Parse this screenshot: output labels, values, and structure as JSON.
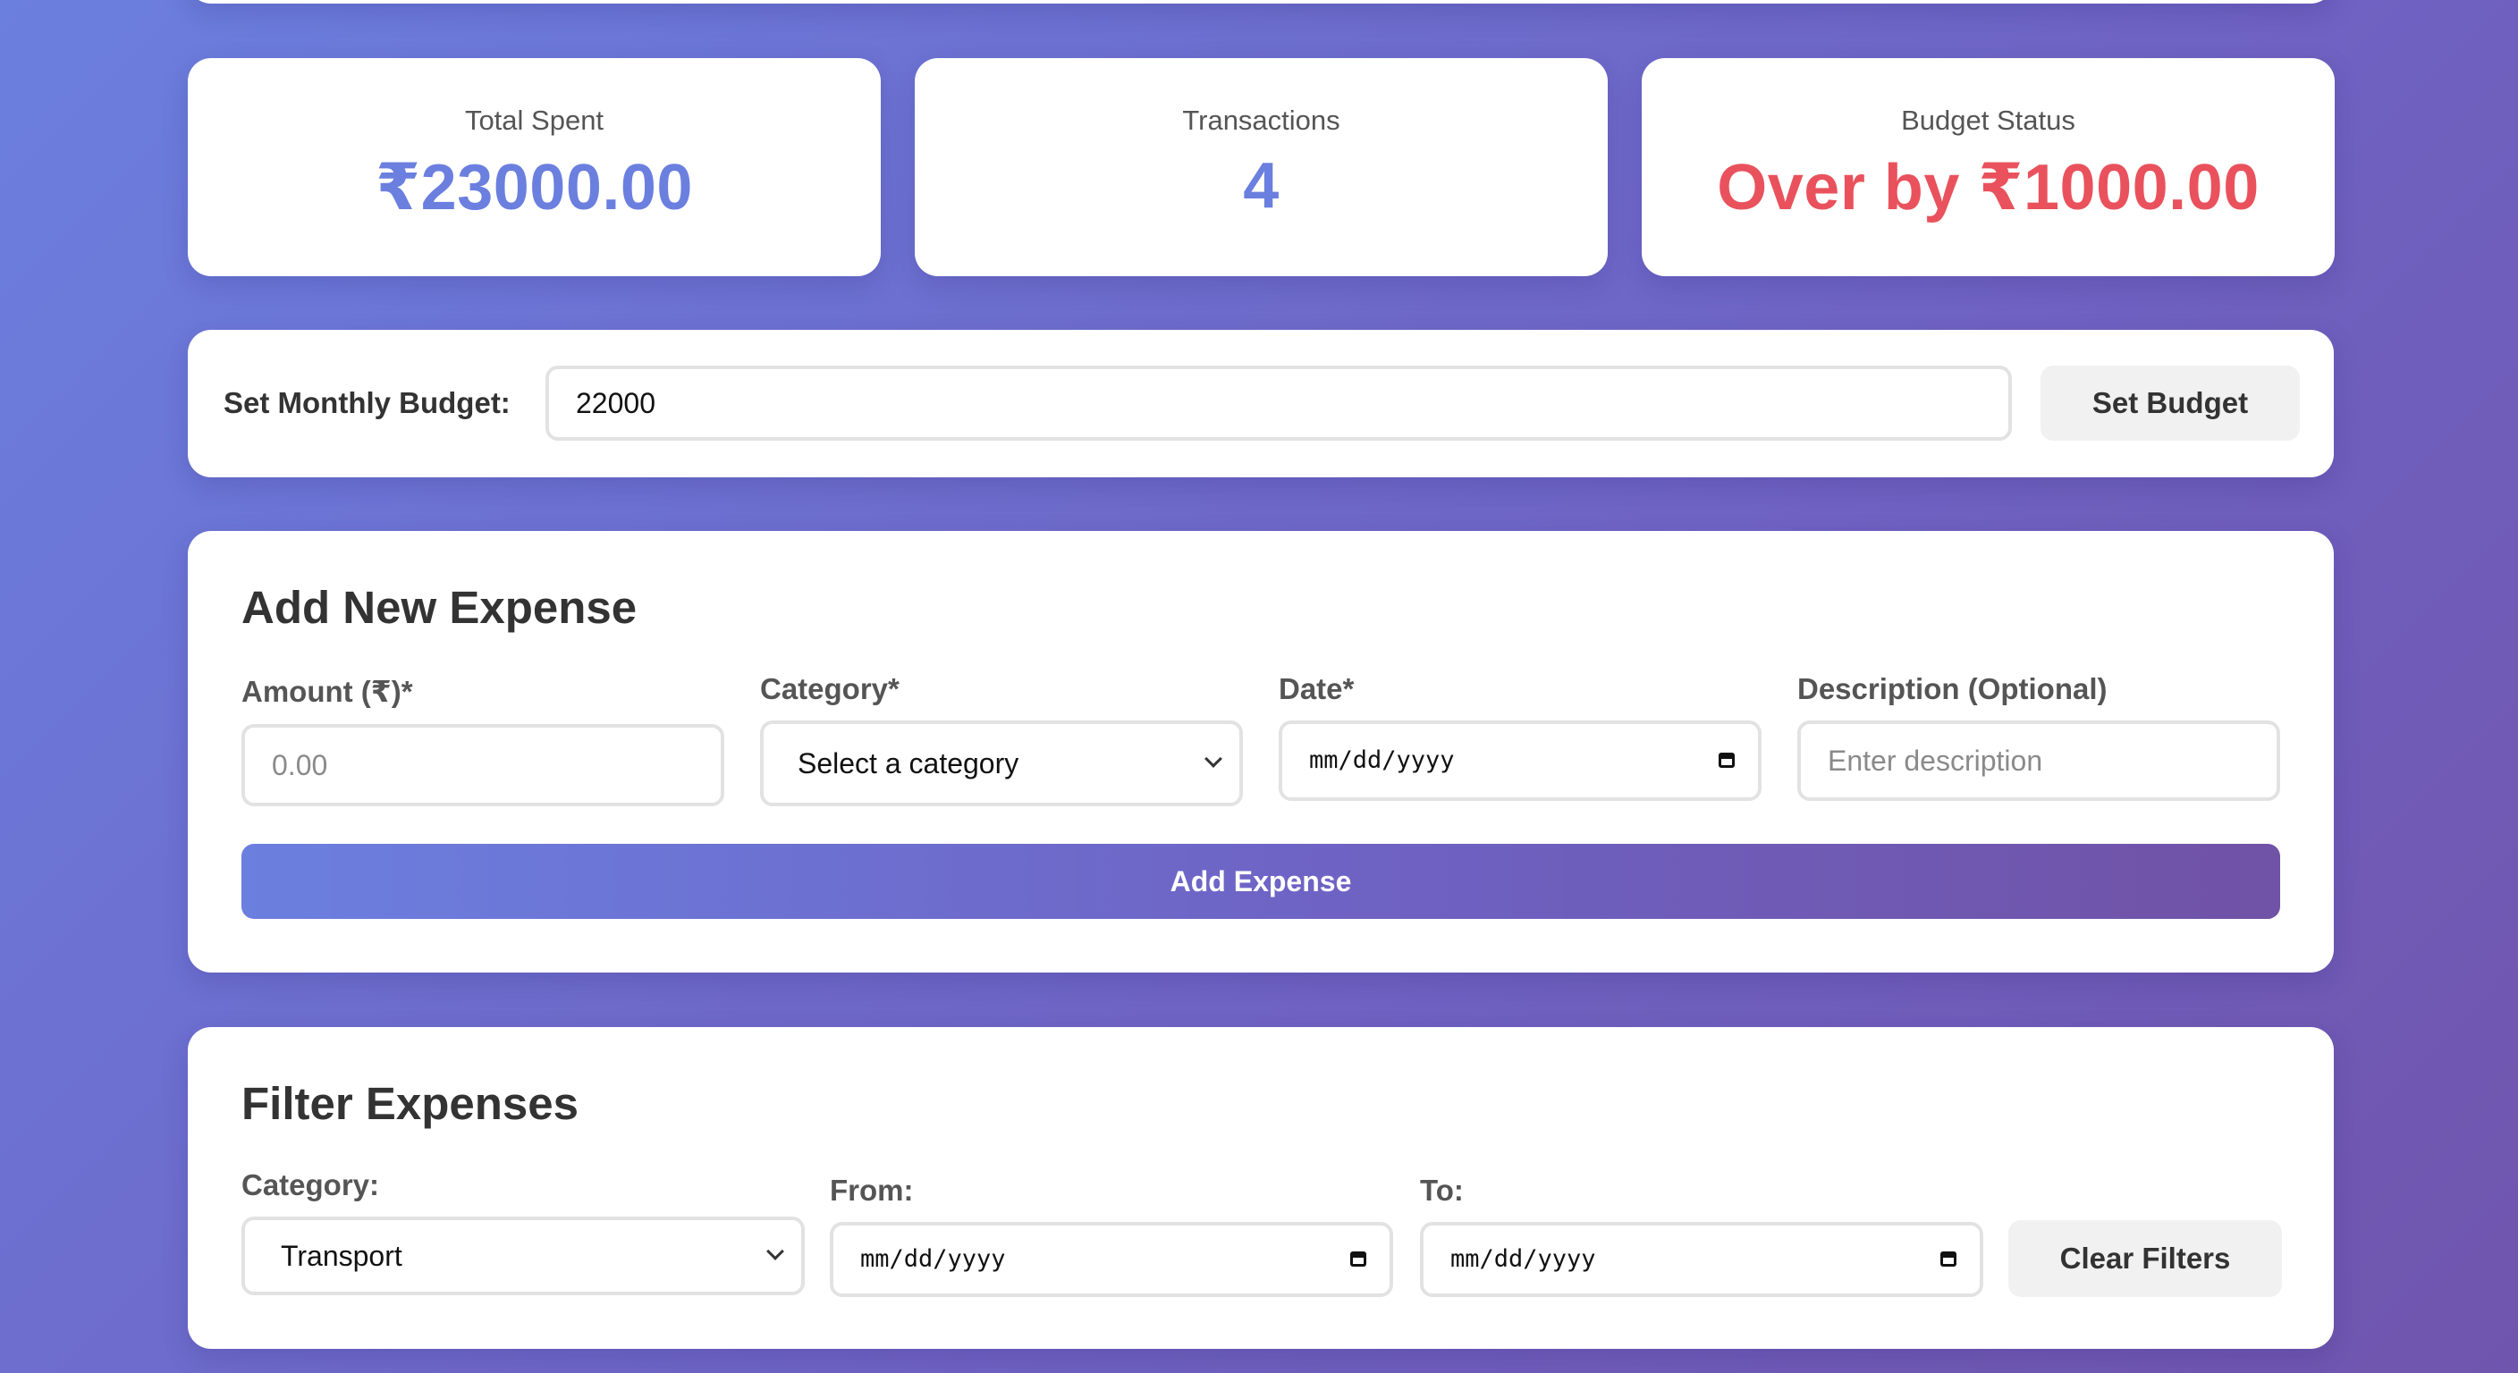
{
  "stats": [
    {
      "label": "Total Spent",
      "value": "₹23000.00"
    },
    {
      "label": "Transactions",
      "value": "4"
    },
    {
      "label": "Budget Status",
      "value": "Over by ₹1000.00"
    }
  ],
  "budget": {
    "label": "Set Monthly Budget:",
    "value": "22000",
    "button": "Set Budget"
  },
  "add_expense": {
    "title": "Add New Expense",
    "amount_label": "Amount (₹)*",
    "amount_placeholder": "0.00",
    "category_label": "Category*",
    "category_value": "Select a category",
    "date_label": "Date*",
    "date_placeholder": "mm/dd/yyyy",
    "description_label": "Description (Optional)",
    "description_placeholder": "Enter description",
    "button": "Add Expense"
  },
  "filter": {
    "title": "Filter Expenses",
    "category_label": "Category:",
    "category_value": "Transport",
    "from_label": "From:",
    "from_placeholder": "mm/dd/yyyy",
    "to_label": "To:",
    "to_placeholder": "mm/dd/yyyy",
    "button": "Clear Filters"
  },
  "colors": {
    "accent": "#6b7fdf",
    "over_budget": "#e9525c",
    "gradient_end": "#7052a6"
  },
  "icons": [
    "chevron-down-icon",
    "calendar-icon"
  ]
}
